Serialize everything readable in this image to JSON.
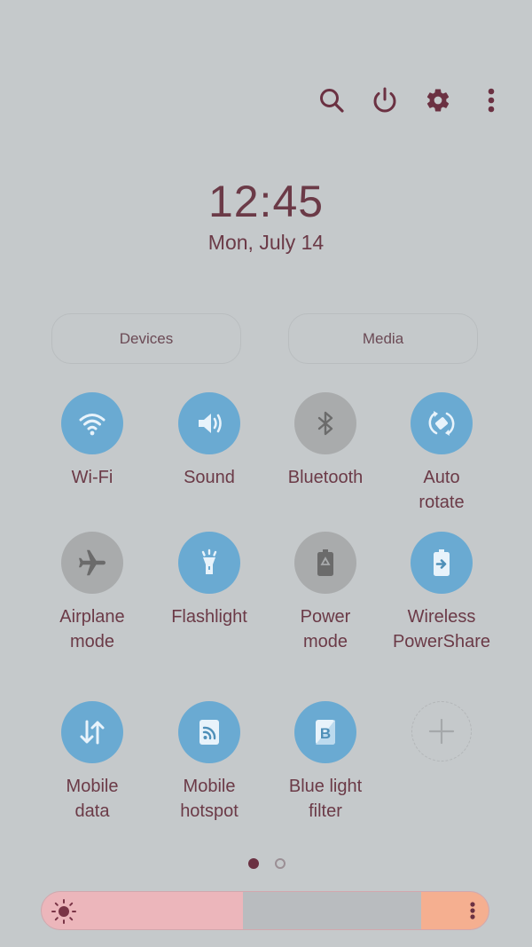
{
  "header": {
    "icons": [
      "search-icon",
      "power-icon",
      "settings-icon",
      "more-options-icon"
    ]
  },
  "clock": {
    "time": "12:45",
    "date": "Mon, July 14"
  },
  "pills": {
    "devices": "Devices",
    "media": "Media"
  },
  "tiles": [
    {
      "label": "Wi-Fi",
      "icon": "wifi-icon",
      "state": "on"
    },
    {
      "label": "Sound",
      "icon": "sound-icon",
      "state": "on"
    },
    {
      "label": "Bluetooth",
      "icon": "bluetooth-icon",
      "state": "off"
    },
    {
      "label": "Auto\nrotate",
      "icon": "auto-rotate-icon",
      "state": "on"
    },
    {
      "label": "Airplane\nmode",
      "icon": "airplane-icon",
      "state": "off"
    },
    {
      "label": "Flashlight",
      "icon": "flashlight-icon",
      "state": "on"
    },
    {
      "label": "Power\nmode",
      "icon": "power-mode-icon",
      "state": "off"
    },
    {
      "label": "Wireless\nPowerShare",
      "icon": "wireless-powershare-icon",
      "state": "on"
    },
    {
      "label": "Mobile\ndata",
      "icon": "mobile-data-icon",
      "state": "on"
    },
    {
      "label": "Mobile\nhotspot",
      "icon": "mobile-hotspot-icon",
      "state": "on"
    },
    {
      "label": "Blue light\nfilter",
      "icon": "blue-light-filter-icon",
      "state": "on"
    },
    {
      "label": "",
      "icon": "add-icon",
      "state": "add"
    }
  ],
  "pagination": {
    "current": 1,
    "total": 2
  },
  "brightness": {
    "level_percent": 45,
    "icon": "sun-icon",
    "menu_icon": "more-options-icon"
  },
  "colors": {
    "background": "#c5c9cb",
    "tile_on": "#6aaad2",
    "tile_off": "#a9abac",
    "text": "#6b3a47",
    "brightness_fill": "#ecb6bb",
    "brightness_end": "#f5af90"
  }
}
